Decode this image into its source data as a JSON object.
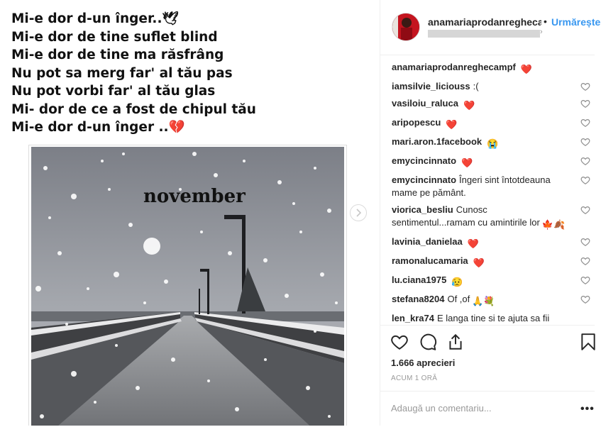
{
  "post": {
    "poem_lines": [
      "Mi-e dor d-un înger..🕊",
      "Mi-e dor de tine suflet blind",
      "Mi-e dor de tine ma răsfrâng",
      "Nu pot sa merg far' al tău pas",
      "Nu pot vorbi far' al tău glas",
      "Mi- dor de ce a fost de chipul tău",
      "Mi-e dor d-un înger ..💔"
    ],
    "image_caption": "november"
  },
  "header": {
    "username": "anamariaprodanreghecampf",
    "dot": "•",
    "follow_label": "Urmărește"
  },
  "comments": [
    {
      "user": "anamariaprodanreghecampf",
      "text": "",
      "emoji": "❤️",
      "like": false
    },
    {
      "user": "iamsilvie_liciouss",
      "text": ":(",
      "emoji": "",
      "like": true
    },
    {
      "user": "vasiloiu_raluca",
      "text": "",
      "emoji": "❤️",
      "like": true
    },
    {
      "user": "aripopescu",
      "text": "",
      "emoji": "❤️",
      "like": true
    },
    {
      "user": "mari.aron.1facebook",
      "text": "",
      "emoji": "😭",
      "like": true
    },
    {
      "user": "emycincinnato",
      "text": "",
      "emoji": "❤️",
      "like": true
    },
    {
      "user": "emycincinnato",
      "text": "Îngeri sint întotdeauna mame pe pământ.",
      "emoji": "",
      "like": true
    },
    {
      "user": "viorica_besliu",
      "text": "Cunosc sentimentul...ramam cu amintirile lor",
      "emoji": "🍁🍂",
      "like": true
    },
    {
      "user": "lavinia_danielaa",
      "text": "",
      "emoji": "❤️",
      "like": true
    },
    {
      "user": "ramonalucamaria",
      "text": "",
      "emoji": "❤️",
      "like": true
    },
    {
      "user": "lu.ciana1975",
      "text": "",
      "emoji": "😥",
      "like": true
    },
    {
      "user": "stefana8204",
      "text": "Of ,of",
      "emoji": "🙏💐",
      "like": true
    },
    {
      "user": "len_kra74",
      "text": "E langa tine si te ajuta sa fii",
      "emoji": "",
      "like": false
    }
  ],
  "actions": {
    "likes_text": "1.666 aprecieri",
    "time_text": "ACUM 1 ORĂ",
    "comment_placeholder": "Adaugă un comentariu...",
    "more_label": "•••"
  }
}
